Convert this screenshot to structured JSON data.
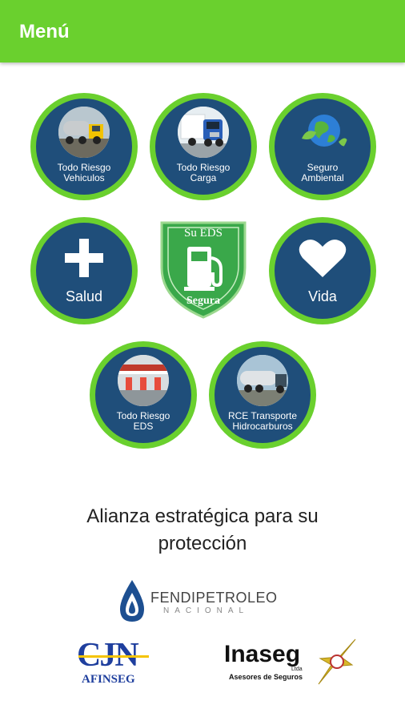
{
  "app_bar": {
    "title": "Menú",
    "color": "#6ad02e"
  },
  "menu": {
    "todo_riesgo_vehiculos": {
      "line1": "Todo Riesgo",
      "line2": "Vehiculos",
      "icon": "truck-tanker-photo"
    },
    "todo_riesgo_carga": {
      "line1": "Todo Riesgo",
      "line2": "Carga",
      "icon": "blue-truck-photo"
    },
    "seguro_ambiental": {
      "line1": "Seguro",
      "line2": "Ambiental",
      "icon": "globe-leaves-icon"
    },
    "salud": {
      "label": "Salud",
      "icon": "plus-icon"
    },
    "center_badge": {
      "top": "Su EDS",
      "bottom": "Segura",
      "icon": "fuel-pump-icon"
    },
    "vida": {
      "label": "Vida",
      "icon": "heart-icon"
    },
    "todo_riesgo_eds": {
      "line1": "Todo Riesgo",
      "line2": "EDS",
      "icon": "gas-station-photo"
    },
    "rce_transporte": {
      "line1": "RCE Transporte",
      "line2": "Hidrocarburos",
      "icon": "tanker-truck-photo"
    }
  },
  "alliance": {
    "line1": "Alianza estratégica para su",
    "line2": "protección"
  },
  "logos": {
    "fendipetroleo": {
      "name": "FENDIPETROLEO",
      "sub": "NACIONAL"
    },
    "cjn": {
      "name": "CJN",
      "sub": "AFINSEG"
    },
    "inaseg": {
      "name": "Inaseg",
      "sub1": "Ltda",
      "sub2": "Asesores de Seguros"
    }
  },
  "colors": {
    "accent": "#6ad02e",
    "tile_blue": "#1f4e7a",
    "shield_green": "#3aa84a"
  }
}
